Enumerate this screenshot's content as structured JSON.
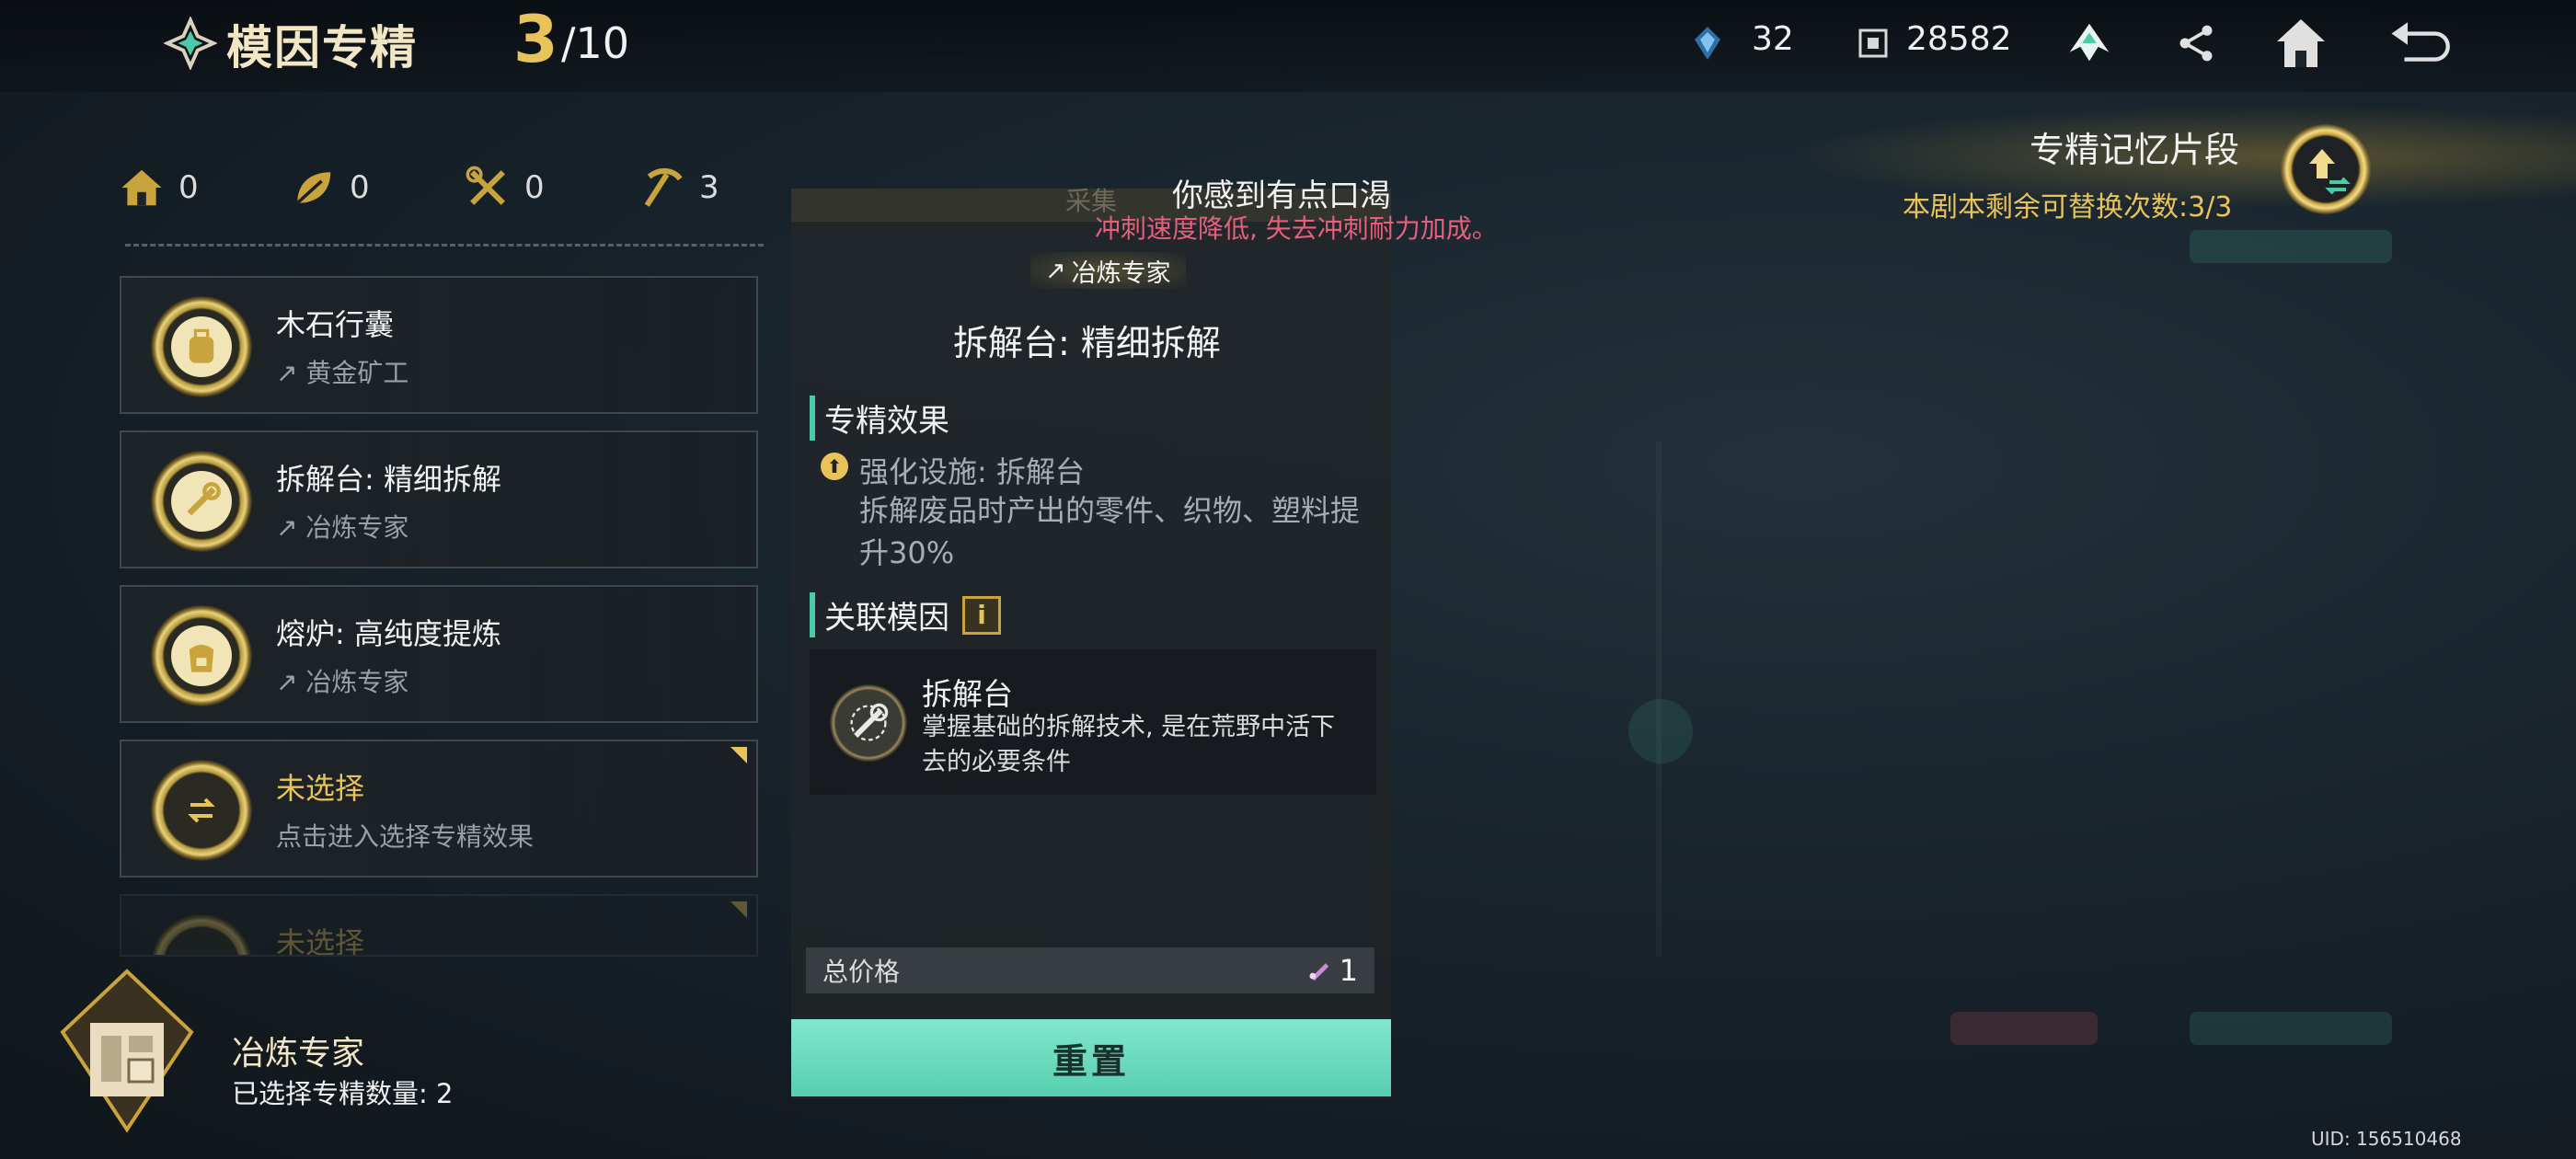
{
  "header": {
    "title": "模因专精",
    "count_current": "3",
    "count_max": "/10",
    "resource1_value": "32",
    "resource2_value": "28582",
    "icons": [
      "meme-logo-icon",
      "crystal-icon",
      "chip-icon",
      "faction-icon",
      "share-icon",
      "home-icon",
      "back-icon"
    ]
  },
  "stats": [
    {
      "icon": "house-icon",
      "value": "0"
    },
    {
      "icon": "leaf-icon",
      "value": "0"
    },
    {
      "icon": "tools-icon",
      "value": "0"
    },
    {
      "icon": "pickaxe-icon",
      "value": "3"
    }
  ],
  "items": [
    {
      "name": "木石行囊",
      "sub": "黄金矿工",
      "icon": "backpack-icon"
    },
    {
      "name": "拆解台: 精细拆解",
      "sub": "冶炼专家",
      "icon": "wrench-icon"
    },
    {
      "name": "熔炉: 高纯度提炼",
      "sub": "冶炼专家",
      "icon": "furnace-icon"
    },
    {
      "name": "未选择",
      "sub": "点击进入选择专精效果",
      "icon": "swap-icon"
    },
    {
      "name": "未选择",
      "sub": "",
      "icon": "swap-icon"
    }
  ],
  "profile": {
    "name": "冶炼专家",
    "count_text": "已选择专精数量: 2"
  },
  "detail": {
    "strip_label": "采集",
    "status_title": "你感到有点口渴",
    "status_sub": "冲刺速度降低, 失去冲刺耐力加成。",
    "path_tag": "冶炼专家",
    "name": "拆解台: 精细拆解",
    "effect_heading": "专精效果",
    "effect_title": "强化设施: 拆解台",
    "effect_desc": "拆解废品时产出的零件、织物、塑料提升30%",
    "gene_heading": "关联模因",
    "gene_name": "拆解台",
    "gene_desc": "掌握基础的拆解技术, 是在荒野中活下去的必要条件",
    "price_label": "总价格",
    "price_value": "1",
    "reset_label": "重置"
  },
  "memory": {
    "title": "专精记忆片段",
    "sub": "本剧本剩余可替换次数:3/3"
  },
  "uid": "UID: 156510468",
  "colors": {
    "gold": "#e7c35a",
    "teal": "#57cfb0",
    "warning_pink": "#e6607c"
  }
}
